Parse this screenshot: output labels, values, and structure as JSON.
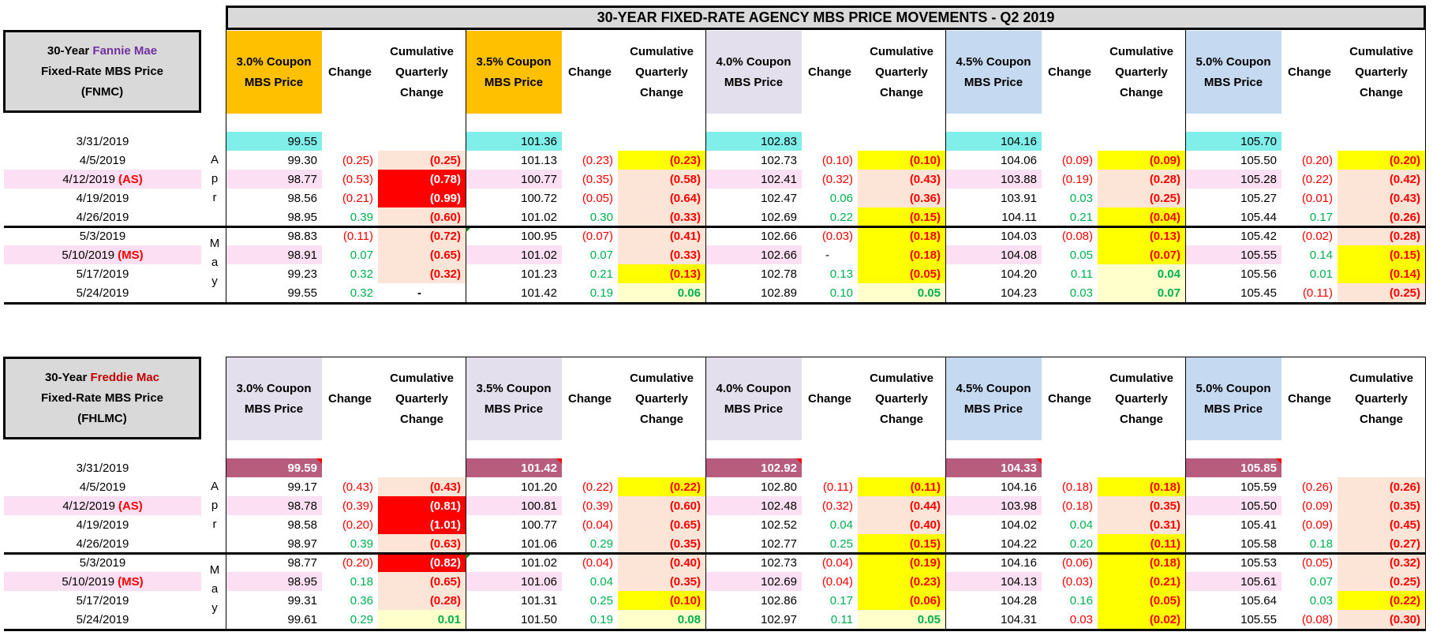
{
  "title": "30-YEAR FIXED-RATE AGENCY MBS PRICE MOVEMENTS - Q2 2019",
  "palette": {
    "orange": "#FFC000",
    "lavender": "#E4DFEC",
    "blue": "#C5D9F1",
    "cyan": "#80EFEA",
    "mauve": "#B85C7D",
    "pink": "#FCDFF3",
    "P": "#FCE4D6",
    "Y": "#FFFF00",
    "R": "#FF0000",
    "L": "#FFFFCC",
    "W": "#FFFFFF",
    "red_text": "#FF0000",
    "green_text": "#00B050",
    "fannie_purple": "#7030A0",
    "freddie_red": "#C00000"
  },
  "headers": {
    "change": "Change",
    "cum": [
      "Cumulative",
      "Quarterly",
      "Change"
    ]
  },
  "dates": [
    {
      "date": "3/31/2019",
      "tag": ""
    },
    {
      "date": "4/5/2019",
      "tag": ""
    },
    {
      "date": "4/12/2019",
      "tag": "(AS)"
    },
    {
      "date": "4/19/2019",
      "tag": ""
    },
    {
      "date": "4/26/2019",
      "tag": ""
    },
    {
      "date": "5/3/2019",
      "tag": ""
    },
    {
      "date": "5/10/2019",
      "tag": "(MS)"
    },
    {
      "date": "5/17/2019",
      "tag": ""
    },
    {
      "date": "5/24/2019",
      "tag": ""
    }
  ],
  "months": {
    "apr": [
      "A",
      "p",
      "r"
    ],
    "may": [
      "M",
      "a",
      "y"
    ]
  },
  "fnmc": {
    "label": {
      "prefix": "30-Year ",
      "agency": "Fannie Mae",
      "line2": "Fixed-Rate MBS Price",
      "line3": "(FNMC)"
    },
    "base_fill": "cyan",
    "groups": [
      {
        "header": [
          "3.0% Coupon",
          "MBS Price"
        ],
        "fill": "orange",
        "prices": [
          "99.55",
          "99.30",
          "98.77",
          "98.56",
          "98.95",
          "98.83",
          "98.91",
          "99.23",
          "99.55"
        ],
        "changes": [
          "(0.25)",
          "(0.53)",
          "(0.21)",
          "0.39",
          "(0.11)",
          "0.07",
          "0.32",
          "0.32"
        ],
        "cum": [
          "(0.25)",
          "(0.78)",
          "(0.99)",
          "(0.60)",
          "(0.72)",
          "(0.65)",
          "(0.32)",
          "-"
        ],
        "cum_fill": [
          "P",
          "R",
          "R",
          "P",
          "P",
          "P",
          "P",
          "W"
        ]
      },
      {
        "header": [
          "3.5% Coupon",
          "MBS Price"
        ],
        "fill": "orange",
        "prices": [
          "101.36",
          "101.13",
          "100.77",
          "100.72",
          "101.02",
          "100.95",
          "101.02",
          "101.23",
          "101.42"
        ],
        "changes": [
          "(0.23)",
          "(0.35)",
          "(0.05)",
          "0.30",
          "(0.07)",
          "0.07",
          "0.21",
          "0.19"
        ],
        "cum": [
          "(0.23)",
          "(0.58)",
          "(0.64)",
          "(0.33)",
          "(0.41)",
          "(0.33)",
          "(0.13)",
          "0.06"
        ],
        "cum_fill": [
          "Y",
          "P",
          "P",
          "P",
          "P",
          "P",
          "Y",
          "L"
        ]
      },
      {
        "header": [
          "4.0% Coupon",
          "MBS Price"
        ],
        "fill": "lavender",
        "prices": [
          "102.83",
          "102.73",
          "102.41",
          "102.47",
          "102.69",
          "102.66",
          "102.66",
          "102.78",
          "102.89"
        ],
        "changes": [
          "(0.10)",
          "(0.32)",
          "0.06",
          "0.22",
          "(0.03)",
          "-",
          "0.13",
          "0.10"
        ],
        "cum": [
          "(0.10)",
          "(0.43)",
          "(0.36)",
          "(0.15)",
          "(0.18)",
          "(0.18)",
          "(0.05)",
          "0.05"
        ],
        "cum_fill": [
          "Y",
          "P",
          "P",
          "Y",
          "Y",
          "Y",
          "Y",
          "L"
        ]
      },
      {
        "header": [
          "4.5% Coupon",
          "MBS Price"
        ],
        "fill": "blue",
        "prices": [
          "104.16",
          "104.06",
          "103.88",
          "103.91",
          "104.11",
          "104.03",
          "104.08",
          "104.20",
          "104.23"
        ],
        "changes": [
          "(0.09)",
          "(0.19)",
          "0.03",
          "0.21",
          "(0.08)",
          "0.05",
          "0.11",
          "0.03"
        ],
        "cum": [
          "(0.09)",
          "(0.28)",
          "(0.25)",
          "(0.04)",
          "(0.13)",
          "(0.07)",
          "0.04",
          "0.07"
        ],
        "cum_fill": [
          "Y",
          "P",
          "P",
          "Y",
          "Y",
          "Y",
          "L",
          "L"
        ]
      },
      {
        "header": [
          "5.0% Coupon",
          "MBS Price"
        ],
        "fill": "blue",
        "prices": [
          "105.70",
          "105.50",
          "105.28",
          "105.27",
          "105.44",
          "105.42",
          "105.55",
          "105.56",
          "105.45"
        ],
        "changes": [
          "(0.20)",
          "(0.22)",
          "(0.01)",
          "0.17",
          "(0.02)",
          "0.14",
          "0.01",
          "(0.11)"
        ],
        "cum": [
          "(0.20)",
          "(0.42)",
          "(0.43)",
          "(0.26)",
          "(0.28)",
          "(0.15)",
          "(0.14)",
          "(0.25)"
        ],
        "cum_fill": [
          "Y",
          "P",
          "P",
          "P",
          "P",
          "Y",
          "Y",
          "P"
        ]
      }
    ]
  },
  "fhlmc": {
    "label": {
      "prefix": "30-Year ",
      "agency": "Freddie Mac",
      "line2": "Fixed-Rate MBS Price",
      "line3": "(FHLMC)"
    },
    "base_fill": "mauve",
    "groups": [
      {
        "header": [
          "3.0% Coupon",
          "MBS Price"
        ],
        "fill": "lavender",
        "prices": [
          "99.59",
          "99.17",
          "98.78",
          "98.58",
          "98.97",
          "98.77",
          "98.95",
          "99.31",
          "99.61"
        ],
        "changes": [
          "(0.43)",
          "(0.39)",
          "(0.20)",
          "0.39",
          "(0.20)",
          "0.18",
          "0.36",
          "0.29"
        ],
        "cum": [
          "(0.43)",
          "(0.81)",
          "(1.01)",
          "(0.63)",
          "(0.82)",
          "(0.65)",
          "(0.28)",
          "0.01"
        ],
        "cum_fill": [
          "P",
          "R",
          "R",
          "P",
          "R",
          "P",
          "P",
          "L"
        ]
      },
      {
        "header": [
          "3.5% Coupon",
          "MBS Price"
        ],
        "fill": "lavender",
        "prices": [
          "101.42",
          "101.20",
          "100.81",
          "100.77",
          "101.06",
          "101.02",
          "101.06",
          "101.31",
          "101.50"
        ],
        "changes": [
          "(0.22)",
          "(0.39)",
          "(0.04)",
          "0.29",
          "(0.04)",
          "0.04",
          "0.25",
          "0.19"
        ],
        "cum": [
          "(0.22)",
          "(0.60)",
          "(0.65)",
          "(0.35)",
          "(0.40)",
          "(0.35)",
          "(0.10)",
          "0.08"
        ],
        "cum_fill": [
          "Y",
          "P",
          "P",
          "P",
          "P",
          "P",
          "Y",
          "L"
        ]
      },
      {
        "header": [
          "4.0% Coupon",
          "MBS Price"
        ],
        "fill": "lavender",
        "prices": [
          "102.92",
          "102.80",
          "102.48",
          "102.52",
          "102.77",
          "102.73",
          "102.69",
          "102.86",
          "102.97"
        ],
        "changes": [
          "(0.11)",
          "(0.32)",
          "0.04",
          "0.25",
          "(0.04)",
          "(0.04)",
          "0.17",
          "0.11"
        ],
        "cum": [
          "(0.11)",
          "(0.44)",
          "(0.40)",
          "(0.15)",
          "(0.19)",
          "(0.23)",
          "(0.06)",
          "0.05"
        ],
        "cum_fill": [
          "Y",
          "P",
          "P",
          "Y",
          "Y",
          "Y",
          "Y",
          "L"
        ]
      },
      {
        "header": [
          "4.5% Coupon",
          "MBS Price"
        ],
        "fill": "blue",
        "prices": [
          "104.33",
          "104.16",
          "103.98",
          "104.02",
          "104.22",
          "104.16",
          "104.13",
          "104.28",
          "104.31"
        ],
        "changes": [
          "(0.18)",
          "(0.18)",
          "0.04",
          "0.20",
          "(0.06)",
          "(0.03)",
          "0.16",
          "0.03"
        ],
        "change_red_override": [
          7
        ],
        "cum": [
          "(0.18)",
          "(0.35)",
          "(0.31)",
          "(0.11)",
          "(0.18)",
          "(0.21)",
          "(0.05)",
          "(0.02)"
        ],
        "cum_fill": [
          "Y",
          "P",
          "P",
          "Y",
          "Y",
          "Y",
          "Y",
          "Y"
        ]
      },
      {
        "header": [
          "5.0% Coupon",
          "MBS Price"
        ],
        "fill": "blue",
        "prices": [
          "105.85",
          "105.59",
          "105.50",
          "105.41",
          "105.58",
          "105.53",
          "105.61",
          "105.64",
          "105.55"
        ],
        "changes": [
          "(0.26)",
          "(0.09)",
          "(0.09)",
          "0.18",
          "(0.05)",
          "0.07",
          "0.03",
          "(0.08)"
        ],
        "cum": [
          "(0.26)",
          "(0.35)",
          "(0.45)",
          "(0.27)",
          "(0.32)",
          "(0.25)",
          "(0.22)",
          "(0.30)"
        ],
        "cum_fill": [
          "P",
          "P",
          "P",
          "P",
          "P",
          "P",
          "Y",
          "P"
        ]
      }
    ]
  }
}
